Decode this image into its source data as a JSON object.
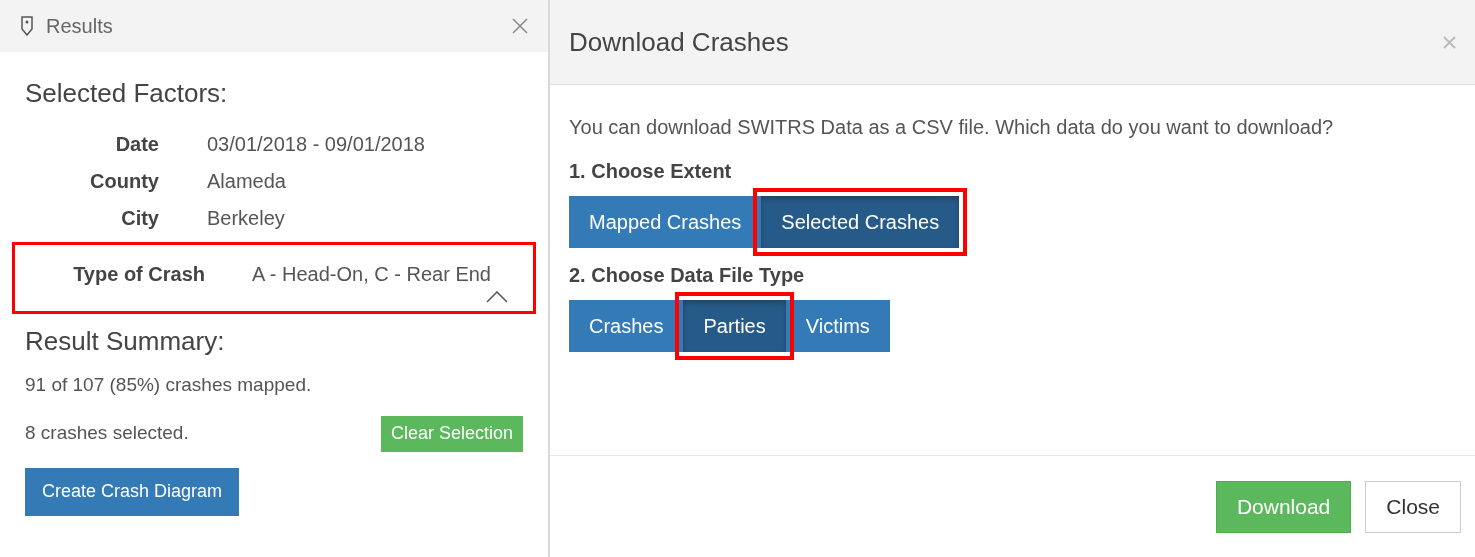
{
  "results_panel": {
    "title": "Results",
    "factors_heading": "Selected Factors:",
    "factors": [
      {
        "label": "Date",
        "value": "03/01/2018 - 09/01/2018",
        "highlighted": false,
        "collapsible": false
      },
      {
        "label": "County",
        "value": "Alameda",
        "highlighted": false,
        "collapsible": false
      },
      {
        "label": "City",
        "value": "Berkeley",
        "highlighted": false,
        "collapsible": false
      },
      {
        "label": "Type of Crash",
        "value": "A - Head-On, C - Rear End",
        "highlighted": true,
        "collapsible": true
      }
    ],
    "summary_heading": "Result Summary:",
    "mapped_text": "91 of 107 (85%) crashes mapped.",
    "selected_text": "8 crashes selected.",
    "clear_button": "Clear Selection",
    "diagram_button": "Create Crash Diagram"
  },
  "download_dialog": {
    "title": "Download Crashes",
    "description": "You can download SWITRS Data as a CSV file. Which data do you want to download?",
    "groups": [
      {
        "heading": "1. Choose Extent",
        "options": [
          {
            "label": "Mapped Crashes",
            "selected": false,
            "highlighted": false
          },
          {
            "label": "Selected Crashes",
            "selected": true,
            "highlighted": true
          }
        ]
      },
      {
        "heading": "2. Choose Data File Type",
        "options": [
          {
            "label": "Crashes",
            "selected": false,
            "highlighted": false
          },
          {
            "label": "Parties",
            "selected": true,
            "highlighted": true
          },
          {
            "label": "Victims",
            "selected": false,
            "highlighted": false
          }
        ]
      }
    ],
    "buttons": [
      {
        "label": "Download",
        "kind": "primary"
      },
      {
        "label": "Close",
        "kind": "default"
      }
    ]
  }
}
